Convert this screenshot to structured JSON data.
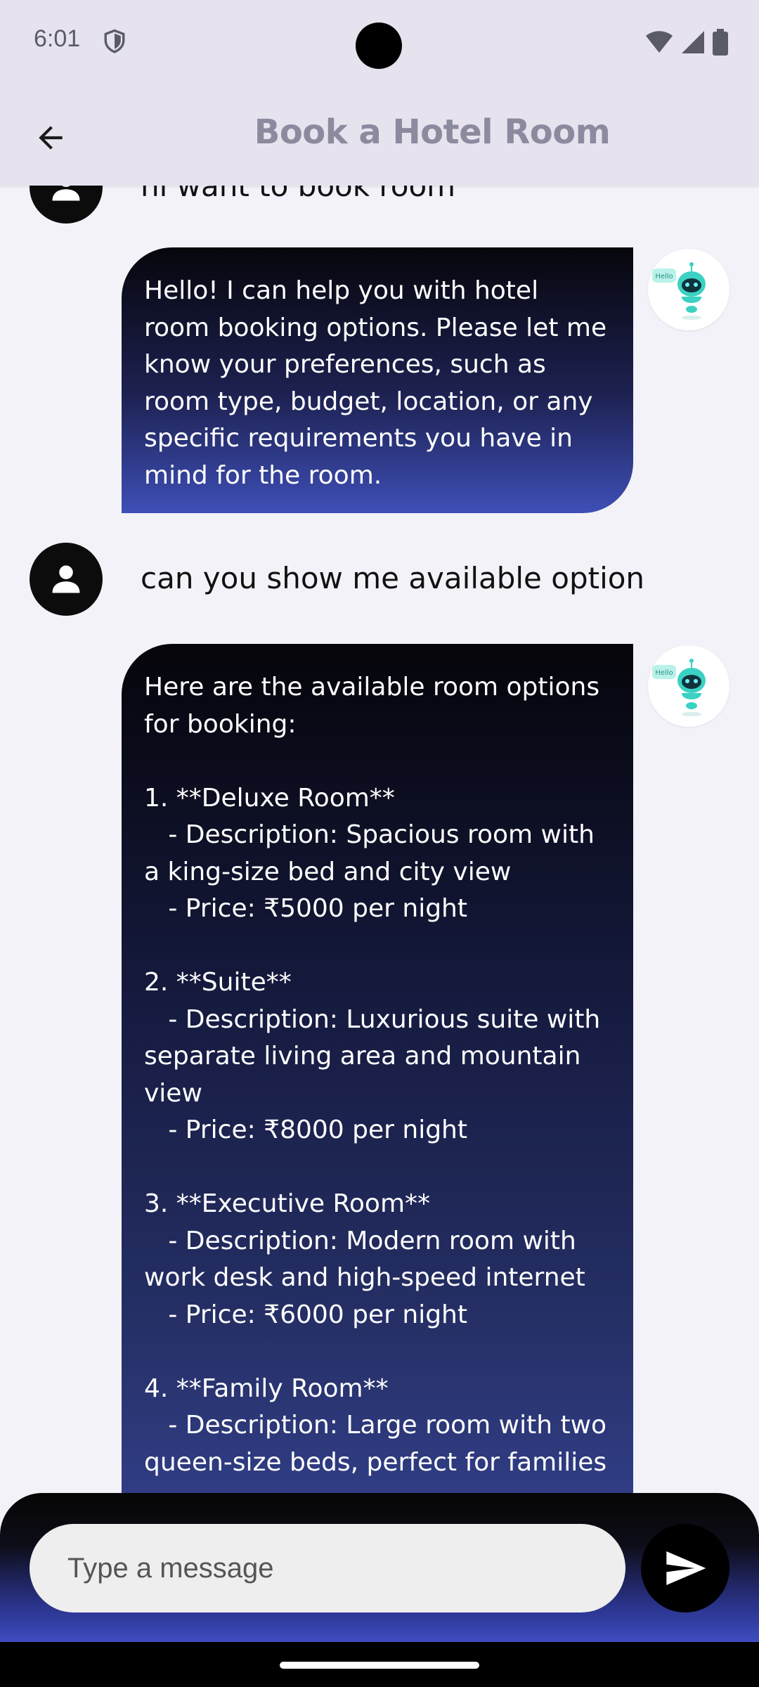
{
  "status_bar": {
    "time": "6:01"
  },
  "app_bar": {
    "title": "Book a Hotel Room"
  },
  "chat": {
    "messages": [
      {
        "role": "user",
        "text": "hi want to book room"
      },
      {
        "role": "bot",
        "text": "Hello! I can help you with hotel room booking options. Please let me know your preferences, such as room type, budget, location, or any specific requirements you have in mind for the room."
      },
      {
        "role": "user",
        "text": "can you show me available option"
      },
      {
        "role": "bot",
        "text": "Here are the available room options for booking:\n\n1. **Deluxe Room**\n   - Description: Spacious room with a king-size bed and city view\n   - Price: ₹5000 per night\n\n2. **Suite**\n   - Description: Luxurious suite with separate living area and mountain view\n   - Price: ₹8000 per night\n\n3. **Executive Room**\n   - Description: Modern room with work desk and high-speed internet\n   - Price: ₹6000 per night\n\n4. **Family Room**\n   - Description: Large room with two queen-size beds, perfect for families"
      }
    ],
    "bot_avatar_badge": "Hello"
  },
  "composer": {
    "placeholder": "Type a message",
    "value": ""
  },
  "icons": {
    "back": "arrow-left-icon",
    "send": "send-icon",
    "user": "person-icon",
    "bot": "robot-icon",
    "shield": "shield-icon",
    "wifi": "wifi-icon",
    "signal": "signal-icon",
    "battery": "battery-icon"
  },
  "colors": {
    "app_bar_bg": "#e6e3ee",
    "title": "#8c8a9e",
    "bubble_top": "#06060c",
    "bubble_bottom": "#3e4fb7",
    "chat_bg": "#f3f2f8"
  }
}
